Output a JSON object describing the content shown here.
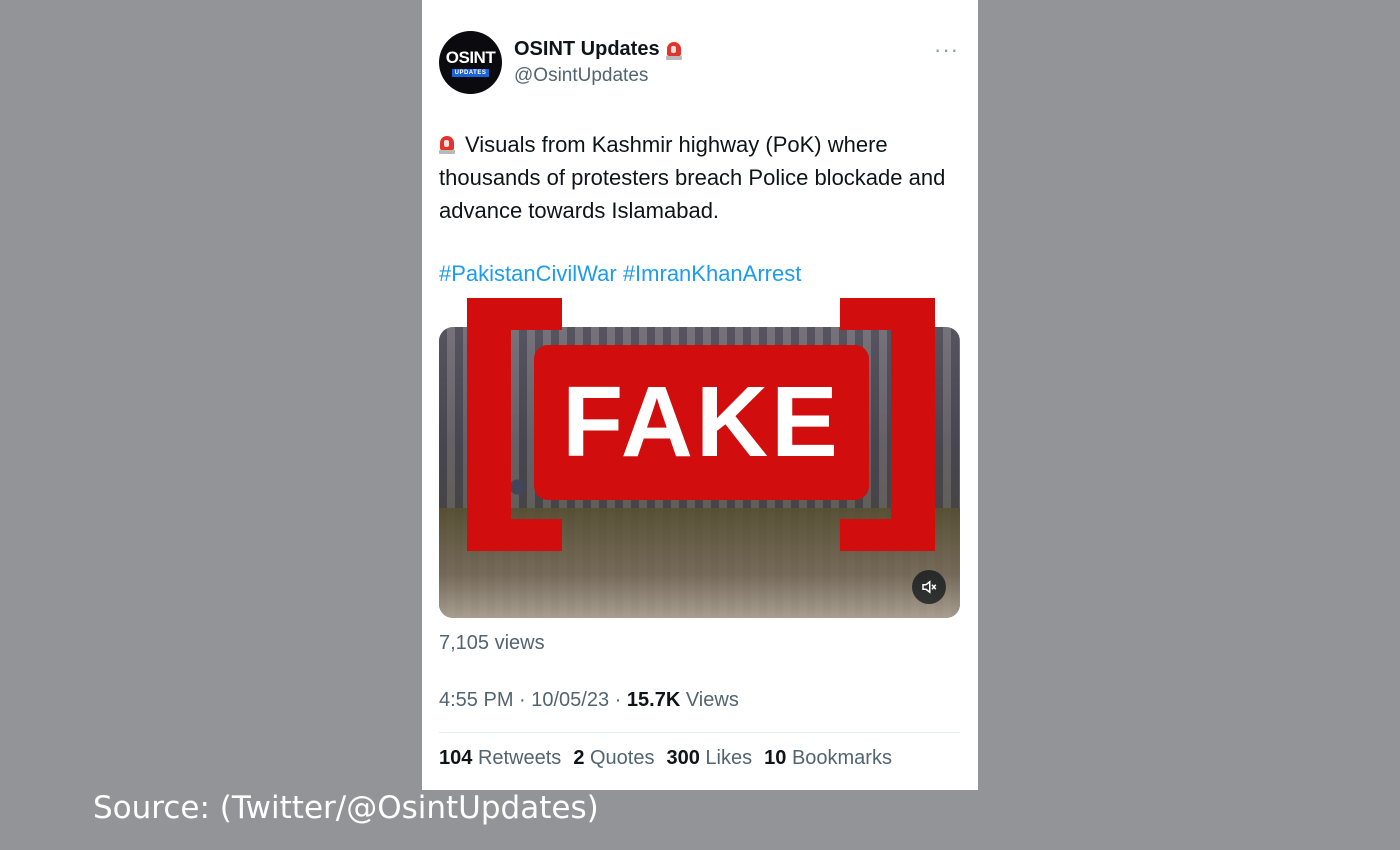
{
  "tweet": {
    "author_name": "OSINT Updates",
    "author_handle": "@OsintUpdates",
    "avatar_line1": "OSINT",
    "avatar_line2": "UPDATES",
    "text": "Visuals from Kashmir highway (PoK) where thousands of protesters breach Police blockade and advance towards Islamabad.",
    "hashtags": [
      "#PakistanCivilWar",
      "#ImranKhanArrest"
    ],
    "video_views": "7,105 views",
    "time": "4:55 PM · 10/05/23 · ",
    "views_count": "15.7K",
    "views_label": "Views",
    "stats": [
      {
        "count": "104",
        "label": "Retweets"
      },
      {
        "count": "2",
        "label": "Quotes"
      },
      {
        "count": "300",
        "label": "Likes"
      },
      {
        "count": "10",
        "label": "Bookmarks"
      }
    ]
  },
  "overlay": {
    "stamp": "FAKE"
  },
  "caption": "Source: (Twitter/@OsintUpdates)",
  "colors": {
    "background": "#939498",
    "stamp_red": "#d10d0d",
    "hashtag_blue": "#1d9bf0"
  },
  "icons": {
    "siren": "siren-emoji-icon",
    "more": "more-dots-icon",
    "mute": "speaker-mute-icon"
  }
}
